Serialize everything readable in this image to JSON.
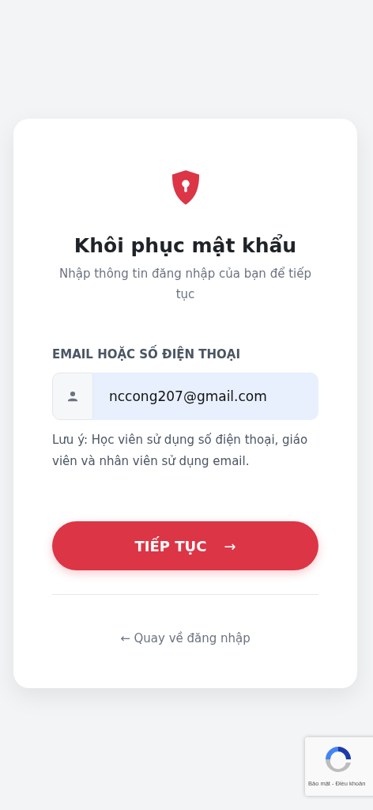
{
  "card": {
    "title": "Khôi phục mật khẩu",
    "subtitle": "Nhập thông tin đăng nhập của bạn để tiếp tục",
    "field": {
      "label": "EMAIL HOẶC SỐ ĐIỆN THOẠI",
      "value": "nccong207@gmail.com",
      "note": "Lưu ý: Học viên sử dụng số điện thoại, giáo viên và nhân viên sử dụng email."
    },
    "submit": {
      "label": "TIẾP TỤC",
      "arrow": "→"
    },
    "back_link": "← Quay về đăng nhập"
  },
  "recaptcha": {
    "links": [
      "Bảo mật",
      "Điều khoản"
    ],
    "separator": "-"
  }
}
